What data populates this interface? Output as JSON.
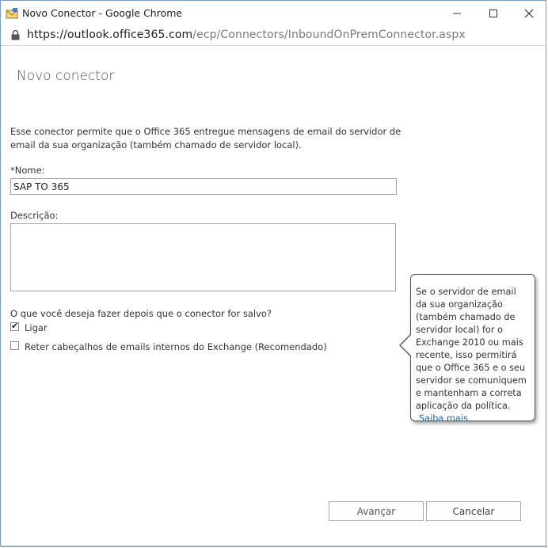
{
  "window": {
    "title": "Novo Conector - Google Chrome",
    "url_host": "https://outlook.office365.com",
    "url_path": "/ecp/Connectors/InboundOnPremConnector.aspx"
  },
  "page": {
    "title": "Novo conector",
    "intro": "Esse conector permite que o Office 365 entregue mensagens de email do servidor de email da sua organização (também chamado de servidor local)."
  },
  "form": {
    "name_label": "*Nome:",
    "name_value": "SAP TO 365",
    "description_label": "Descrição:",
    "description_value": "",
    "after_save_label": "O que você deseja fazer depois que o conector for salvo?",
    "options": [
      {
        "label": "Ligar",
        "checked": true
      },
      {
        "label": "Reter cabeçalhos de emails internos do Exchange (Recomendado)",
        "checked": false
      }
    ]
  },
  "callout": {
    "text": "Se o servidor de email da sua organização (também chamado de servidor local) for o Exchange 2010 ou mais recente, isso permitirá que o Office 365 e o seu servidor se comuniquem e mantenham a correta aplicação da política.",
    "link": "Saiba mais"
  },
  "buttons": {
    "next": "Avançar",
    "cancel": "Cancelar"
  }
}
